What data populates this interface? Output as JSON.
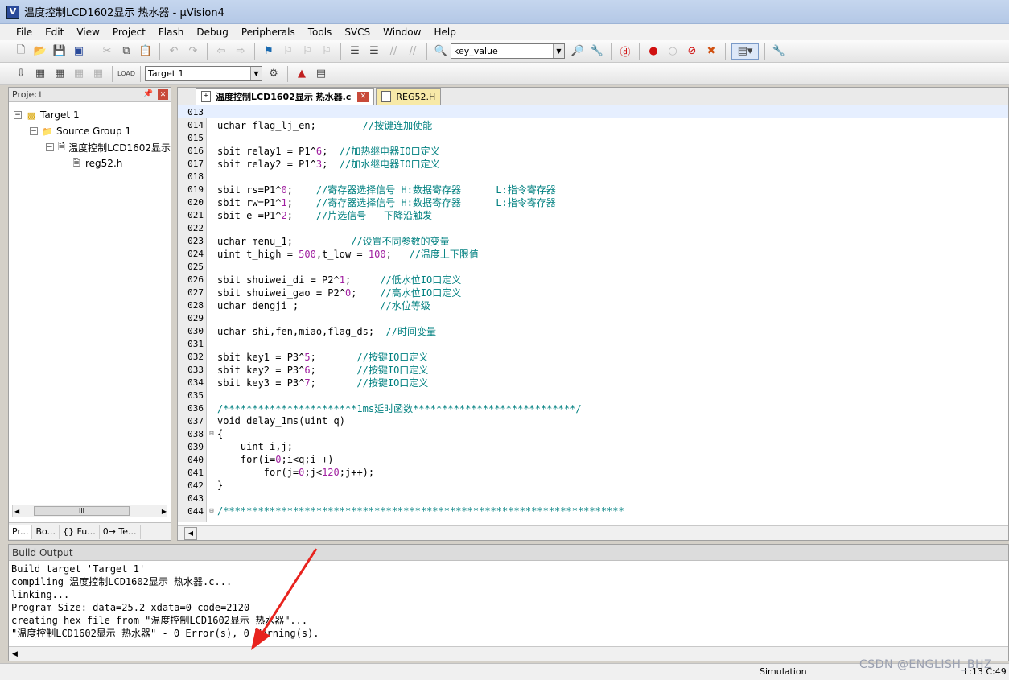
{
  "window": {
    "title": "温度控制LCD1602显示 热水器 - μVision4",
    "app_icon": "V"
  },
  "menu": [
    "File",
    "Edit",
    "View",
    "Project",
    "Flash",
    "Debug",
    "Peripherals",
    "Tools",
    "SVCS",
    "Window",
    "Help"
  ],
  "toolbar": {
    "find_combo_value": "key_value",
    "target_combo_value": "Target 1"
  },
  "project_panel": {
    "header": "Project",
    "tree": [
      {
        "label": "Target 1",
        "level": 0,
        "icon": "target-icon"
      },
      {
        "label": "Source Group 1",
        "level": 1,
        "icon": "folder-icon"
      },
      {
        "label": "温度控制LCD1602显示",
        "level": 2,
        "icon": "c-file-icon"
      },
      {
        "label": "reg52.h",
        "level": 3,
        "icon": "h-file-icon"
      }
    ],
    "tabs": [
      "Pr...",
      "Bo...",
      "{} Fu...",
      "0→ Te..."
    ]
  },
  "editor": {
    "tabs": [
      {
        "label": "温度控制LCD1602显示 热水器.c",
        "active": true
      },
      {
        "label": "REG52.H",
        "active": false
      }
    ],
    "lines": [
      {
        "n": "013",
        "code": "",
        "comment": "",
        "fold": ""
      },
      {
        "n": "014",
        "code": "uchar flag_lj_en;        ",
        "comment": "//按键连加使能",
        "fold": ""
      },
      {
        "n": "015",
        "code": "",
        "comment": "",
        "fold": ""
      },
      {
        "n": "016",
        "code": "sbit relay1 = P1^6;  ",
        "comment": "//加热继电器IO口定义",
        "fold": ""
      },
      {
        "n": "017",
        "code": "sbit relay2 = P1^3;  ",
        "comment": "//加水继电器IO口定义",
        "fold": ""
      },
      {
        "n": "018",
        "code": "",
        "comment": "",
        "fold": ""
      },
      {
        "n": "019",
        "code": "sbit rs=P1^0;    ",
        "comment": "//寄存器选择信号 H:数据寄存器      L:指令寄存器",
        "fold": ""
      },
      {
        "n": "020",
        "code": "sbit rw=P1^1;    ",
        "comment": "//寄存器选择信号 H:数据寄存器      L:指令寄存器",
        "fold": ""
      },
      {
        "n": "021",
        "code": "sbit e =P1^2;    ",
        "comment": "//片选信号   下降沿触发",
        "fold": ""
      },
      {
        "n": "022",
        "code": "",
        "comment": "",
        "fold": ""
      },
      {
        "n": "023",
        "code": "uchar menu_1;          ",
        "comment": "//设置不同参数的变量",
        "fold": ""
      },
      {
        "n": "024",
        "code": "uint t_high = 500,t_low = 100;   ",
        "comment": "//温度上下限值",
        "fold": ""
      },
      {
        "n": "025",
        "code": "",
        "comment": "",
        "fold": ""
      },
      {
        "n": "026",
        "code": "sbit shuiwei_di = P2^1;     ",
        "comment": "//低水位IO口定义",
        "fold": ""
      },
      {
        "n": "027",
        "code": "sbit shuiwei_gao = P2^0;    ",
        "comment": "//高水位IO口定义",
        "fold": ""
      },
      {
        "n": "028",
        "code": "uchar dengji ;              ",
        "comment": "//水位等级",
        "fold": ""
      },
      {
        "n": "029",
        "code": "",
        "comment": "",
        "fold": ""
      },
      {
        "n": "030",
        "code": "uchar shi,fen,miao,flag_ds;  ",
        "comment": "//时间变量",
        "fold": ""
      },
      {
        "n": "031",
        "code": "",
        "comment": "",
        "fold": ""
      },
      {
        "n": "032",
        "code": "sbit key1 = P3^5;       ",
        "comment": "//按键IO口定义",
        "fold": ""
      },
      {
        "n": "033",
        "code": "sbit key2 = P3^6;       ",
        "comment": "//按键IO口定义",
        "fold": ""
      },
      {
        "n": "034",
        "code": "sbit key3 = P3^7;       ",
        "comment": "//按键IO口定义",
        "fold": ""
      },
      {
        "n": "035",
        "code": "",
        "comment": "",
        "fold": ""
      },
      {
        "n": "036",
        "code": "",
        "comment": "/***********************1ms延时函数****************************/",
        "fold": ""
      },
      {
        "n": "037",
        "code": "void delay_1ms(uint q)",
        "comment": "",
        "fold": ""
      },
      {
        "n": "038",
        "code": "{",
        "comment": "",
        "fold": "−"
      },
      {
        "n": "039",
        "code": "    uint i,j;",
        "comment": "",
        "fold": ""
      },
      {
        "n": "040",
        "code": "    for(i=0;i<q;i++)",
        "comment": "",
        "fold": ""
      },
      {
        "n": "041",
        "code": "        for(j=0;j<120;j++);",
        "comment": "",
        "fold": ""
      },
      {
        "n": "042",
        "code": "}",
        "comment": "",
        "fold": ""
      },
      {
        "n": "043",
        "code": "",
        "comment": "",
        "fold": ""
      },
      {
        "n": "044",
        "code": "",
        "comment": "/*********************************************************************",
        "fold": "−"
      }
    ]
  },
  "build_output": {
    "header": "Build Output",
    "lines": [
      "Build target 'Target 1'",
      "compiling 温度控制LCD1602显示 热水器.c...",
      "linking...",
      "Program Size: data=25.2 xdata=0 code=2120",
      "creating hex file from \"温度控制LCD1602显示 热水器\"...",
      "\"温度控制LCD1602显示 热水器\" - 0 Error(s), 0 Warning(s)."
    ]
  },
  "status": {
    "mode": "Simulation",
    "position": "L:13 C:49"
  },
  "watermark": "CSDN @ENGLISH_BHZ",
  "colors": {
    "comment": "#008080",
    "number": "#a020a0",
    "arrow": "#e8231e"
  }
}
